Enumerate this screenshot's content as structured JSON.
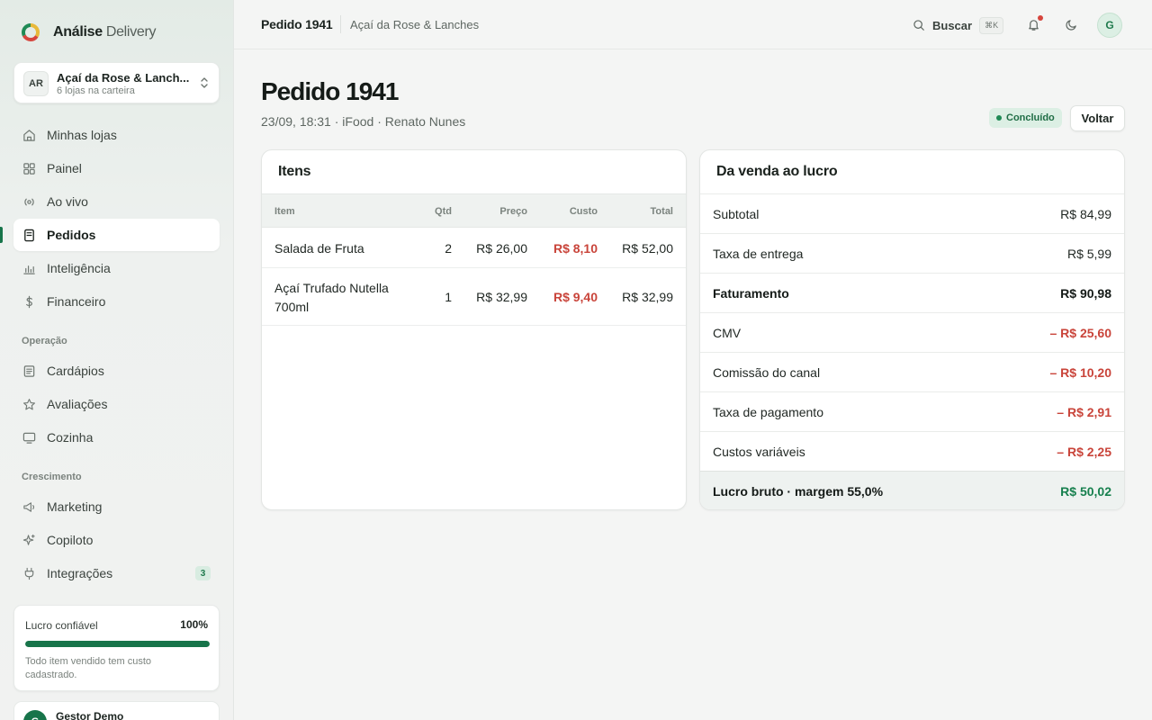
{
  "brand": {
    "name": "Análise",
    "suffix": "Delivery"
  },
  "store": {
    "initials": "AR",
    "name": "Açaí da Rose & Lanch...",
    "subtitle": "6 lojas na carteira"
  },
  "nav": {
    "main": [
      {
        "label": "Minhas lojas",
        "icon": "home-icon"
      },
      {
        "label": "Painel",
        "icon": "grid-icon"
      },
      {
        "label": "Ao vivo",
        "icon": "broadcast-icon"
      },
      {
        "label": "Pedidos",
        "icon": "receipt-icon",
        "active": true
      },
      {
        "label": "Inteligência",
        "icon": "bar-chart-icon"
      },
      {
        "label": "Financeiro",
        "icon": "dollar-icon"
      }
    ],
    "section_operacao": "Operação",
    "operacao": [
      {
        "label": "Cardápios",
        "icon": "menu-doc-icon"
      },
      {
        "label": "Avaliações",
        "icon": "star-icon"
      },
      {
        "label": "Cozinha",
        "icon": "monitor-icon"
      }
    ],
    "section_crescimento": "Crescimento",
    "crescimento": [
      {
        "label": "Marketing",
        "icon": "megaphone-icon"
      },
      {
        "label": "Copiloto",
        "icon": "sparkle-icon"
      },
      {
        "label": "Integrações",
        "icon": "plug-icon",
        "badge": "3"
      }
    ]
  },
  "trust": {
    "label": "Lucro confiável",
    "percent": "100%",
    "fill": 1.0,
    "note": "Todo item vendido tem custo cadastrado."
  },
  "user": {
    "initial": "G",
    "name": "Gestor Demo"
  },
  "topbar": {
    "title": "Pedido 1941",
    "store": "Açaí da Rose & Lanches",
    "search": "Buscar",
    "shortcut": "⌘K",
    "avatar": "G"
  },
  "order": {
    "title": "Pedido 1941",
    "meta": "23/09, 18:31 · iFood · Renato Nunes",
    "status": "Concluído",
    "back": "Voltar"
  },
  "items": {
    "title": "Itens",
    "headers": {
      "item": "Item",
      "qty": "Qtd",
      "price": "Preço",
      "cost": "Custo",
      "total": "Total"
    },
    "rows": [
      {
        "name": "Salada de Fruta",
        "qty": "2",
        "price": "R$ 26,00",
        "cost": "R$ 8,10",
        "total": "R$ 52,00"
      },
      {
        "name": "Açaí Trufado Nutella 700ml",
        "qty": "1",
        "price": "R$ 32,99",
        "cost": "R$ 9,40",
        "total": "R$ 32,99"
      }
    ]
  },
  "profit": {
    "title": "Da venda ao lucro",
    "rows": [
      {
        "label": "Subtotal",
        "value": "R$ 84,99"
      },
      {
        "label": "Taxa de entrega",
        "value": "R$ 5,99"
      },
      {
        "label": "Faturamento",
        "value": "R$ 90,98"
      },
      {
        "label": "CMV",
        "value": "– R$ 25,60"
      },
      {
        "label": "Comissão do canal",
        "value": "– R$ 10,20"
      },
      {
        "label": "Taxa de pagamento",
        "value": "– R$ 2,91"
      },
      {
        "label": "Custos variáveis",
        "value": "– R$ 2,25"
      }
    ],
    "total": {
      "label": "Lucro bruto · margem 55,0%",
      "value": "R$ 50,02"
    }
  },
  "colors": {
    "accent": "#17744a",
    "negative": "#c9443a",
    "positive": "#17804e"
  }
}
